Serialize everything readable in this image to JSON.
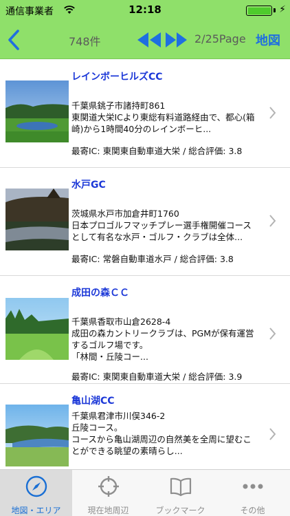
{
  "status_bar": {
    "carrier": "通信事業者",
    "time": "12:18"
  },
  "nav": {
    "count": "748件",
    "page": "2/25Page",
    "map_label": "地図"
  },
  "courses": [
    {
      "name": "レインボーヒルズCC",
      "address": "千葉県銚子市諸持町861",
      "desc1": "東関道大栄ICより東総有料道路経由で、都心(箱",
      "desc2": "崎)から1時間40分のレインボーヒ...",
      "desc3": "",
      "footer": "最寄IC: 東関東自動車道大栄 / 総合評価: 3.8",
      "rating": 3.8
    },
    {
      "name": "水戸GC",
      "address": "茨城県水戸市加倉井町1760",
      "desc1": "日本プロゴルフマッチプレー選手権開催コース",
      "desc2": "として有名な水戸・ゴルフ・クラブは全体...",
      "desc3": "",
      "footer": "最寄IC: 常磐自動車道水戸 / 総合評価: 3.8",
      "rating": 3.8
    },
    {
      "name": "成田の森ＣＣ",
      "address": "千葉県香取市山倉2628-4",
      "desc1": "成田の森カントリークラブは、PGMが保有運営",
      "desc2": "するゴルフ場です。",
      "desc3": "「林間・丘陵コー...",
      "footer": "最寄IC: 東関東自動車道大栄 / 総合評価: 3.9",
      "rating": 3.9
    },
    {
      "name": "亀山湖CC",
      "address": "千葉県君津市川俣346-2",
      "desc1": "丘陵コース。",
      "desc2": "コースから亀山湖周辺の自然美を全周に望むこ",
      "desc3": "とができる眺望の素晴らし...",
      "footer": "",
      "rating": null
    }
  ],
  "tabs": [
    {
      "label": "地図・エリア",
      "icon": "compass-icon",
      "active": true
    },
    {
      "label": "現在地周辺",
      "icon": "crosshair-icon",
      "active": false
    },
    {
      "label": "ブックマーク",
      "icon": "book-icon",
      "active": false
    },
    {
      "label": "その他",
      "icon": "more-icon",
      "active": false
    }
  ],
  "colors": {
    "bar_green": "#8fe06a",
    "accent_blue": "#1f6fe0",
    "title_blue": "#1d39d8"
  }
}
